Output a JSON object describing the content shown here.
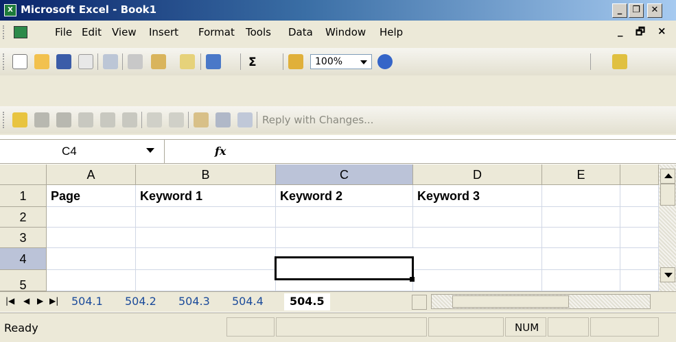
{
  "window": {
    "title": "Microsoft Excel - Book1"
  },
  "menu": {
    "items": [
      "File",
      "Edit",
      "View",
      "Insert",
      "Format",
      "Tools",
      "Data",
      "Window",
      "Help"
    ]
  },
  "toolbar": {
    "zoom": "100%",
    "reply_label": "Reply with Changes..."
  },
  "formula_bar": {
    "name_box": "C4",
    "fx_label": "fx",
    "formula": ""
  },
  "grid": {
    "columns": [
      "A",
      "B",
      "C",
      "D",
      "E"
    ],
    "rows": [
      "1",
      "2",
      "3",
      "4",
      "5"
    ],
    "cells": {
      "A1": "Page",
      "B1": "Keyword 1",
      "C1": "Keyword 2",
      "D1": "Keyword 3"
    },
    "selected_cell": "C4"
  },
  "sheets": {
    "tabs": [
      "504.1",
      "504.2",
      "504.3",
      "504.4",
      "504.5"
    ],
    "active": "504.5"
  },
  "status": {
    "state": "Ready",
    "num": "NUM"
  },
  "colors": {
    "title_bar": "#0a246a",
    "chrome": "#ece9d8",
    "active_header": "#bbc3d8",
    "sheet_tab_text": "#1a4a9a"
  }
}
